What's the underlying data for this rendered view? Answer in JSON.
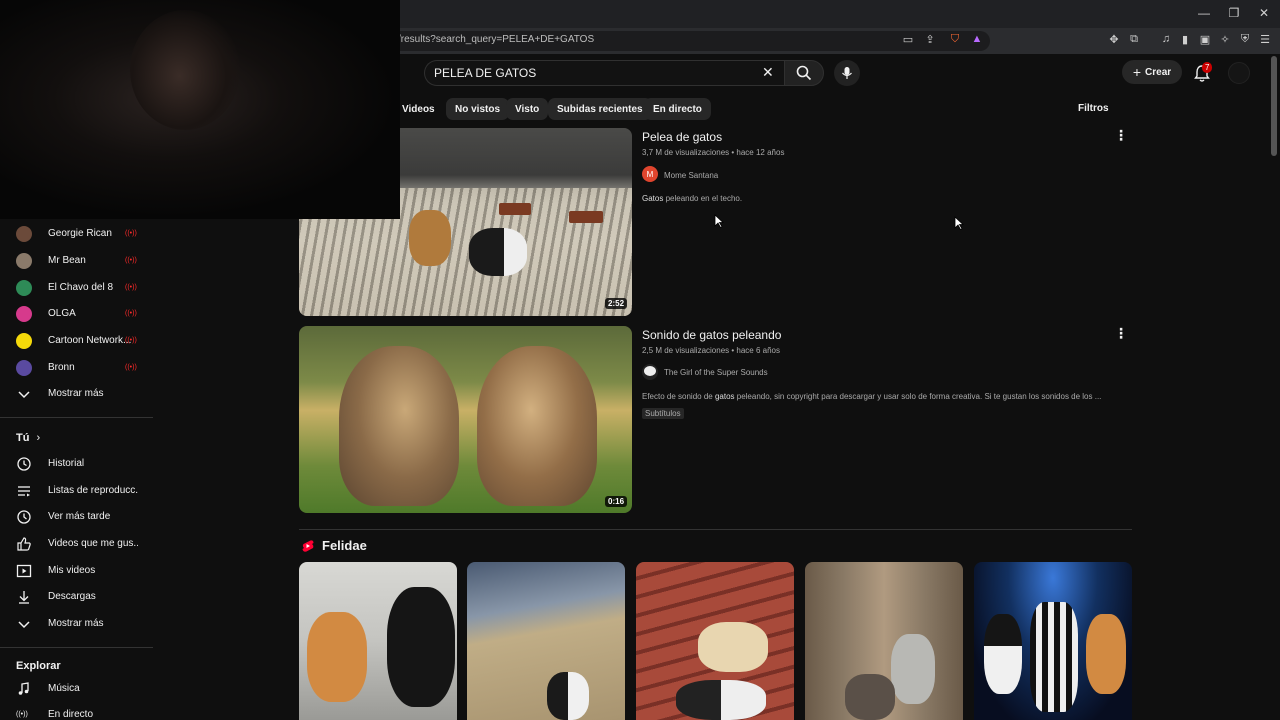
{
  "browser": {
    "url": "/results?search_query=PELEA+DE+GATOS"
  },
  "header": {
    "search_value": "PELEA DE GATOS",
    "create_label": "Crear",
    "notif_count": "7"
  },
  "chips": [
    "Videos",
    "No vistos",
    "Visto",
    "Subidas recientes",
    "En directo"
  ],
  "filters_label": "Filtros",
  "sidebar": {
    "subscriptions": [
      {
        "name": "Georgie Rican",
        "color": "#6b4a3a"
      },
      {
        "name": "Mr Bean",
        "color": "#8a7a6a"
      },
      {
        "name": "El Chavo del 8",
        "color": "#2e8b57"
      },
      {
        "name": "OLGA",
        "color": "#d63a8c"
      },
      {
        "name": "Cartoon Network...",
        "color": "#f5d90a"
      },
      {
        "name": "Bronn",
        "color": "#5a4aa0"
      }
    ],
    "show_more": "Mostrar más",
    "you_heading": "Tú",
    "you_items": [
      "Historial",
      "Listas de reproducc...",
      "Ver más tarde",
      "Videos que me gus...",
      "Mis videos",
      "Descargas"
    ],
    "show_more_2": "Mostrar más",
    "explore_heading": "Explorar",
    "explore_items": [
      "Música",
      "En directo"
    ]
  },
  "results": [
    {
      "title": "Pelea de gatos",
      "meta": "3,7 M de visualizaciones • hace 12 años",
      "channel": "Mome Santana",
      "channel_initial": "M",
      "desc_bold": "Gatos",
      "desc_rest": " peleando en el techo.",
      "duration": "2:52"
    },
    {
      "title": "Sonido de gatos peleando",
      "meta": "2,5 M de visualizaciones • hace 6 años",
      "channel": "The Girl of the Super Sounds",
      "desc_pre": "Efecto de sonido de ",
      "desc_bold": "gatos",
      "desc_rest": " peleando, sin copyright para descargar y usar solo de forma creativa. Si te gustan los sonidos de los ...",
      "tag": "Subtítulos",
      "duration": "0:16"
    }
  ],
  "shelf": {
    "title": "Felidae"
  }
}
